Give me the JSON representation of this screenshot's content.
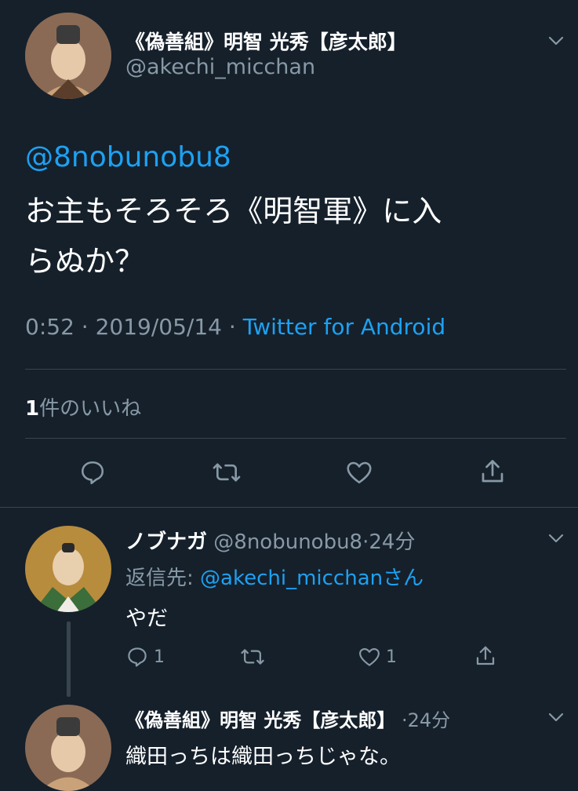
{
  "main_tweet": {
    "display_name": "《偽善組》明智 光秀【彦太郎】",
    "handle": "@akechi_micchan",
    "mention": "@8nobunobu8",
    "text_line1": "お主もそろそろ《明智軍》に入",
    "text_line2": "らぬか？",
    "time": "0:52",
    "date": "2019/05/14",
    "dot": "·",
    "source": "Twitter for Android",
    "likes_count": "1",
    "likes_label": "件のいいね"
  },
  "reply1": {
    "display_name": "ノブナガ",
    "handle": "@8nobunobu8",
    "age": "24分",
    "reply_to_label": "返信先: ",
    "reply_to_handle": "@akechi_micchan",
    "reply_to_suffix": "さん",
    "text": "やだ",
    "reply_count": "1",
    "like_count": "1"
  },
  "reply2": {
    "display_name": "《偽善組》明智 光秀【彦太郎】",
    "age": "24分",
    "text": "織田っちは織田っちじゃな。"
  },
  "icons": [
    "chevron-down-icon",
    "reply-icon",
    "retweet-icon",
    "like-icon",
    "share-icon"
  ],
  "colors": {
    "background": "#15202b",
    "link": "#1da1f2",
    "muted": "#8899a6",
    "divider": "#38444d"
  }
}
